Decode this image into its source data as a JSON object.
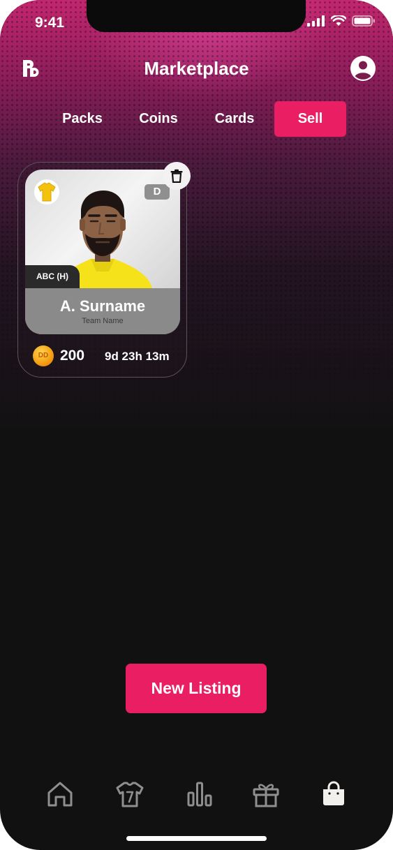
{
  "status_bar": {
    "time": "9:41"
  },
  "header": {
    "title": "Marketplace",
    "logo_icon": "app-logo-icon",
    "profile_icon": "user-profile-icon"
  },
  "tabs": [
    {
      "label": "Packs",
      "active": false
    },
    {
      "label": "Coins",
      "active": false
    },
    {
      "label": "Cards",
      "active": false
    },
    {
      "label": "Sell",
      "active": true
    }
  ],
  "listing_card": {
    "player_name": "A. Surname",
    "team_name": "Team Name",
    "fixture_tag": "ABC (H)",
    "position_badge": "D",
    "coin_label": "DD",
    "price": "200",
    "time_remaining": "9d 23h 13m"
  },
  "actions": {
    "new_listing_label": "New Listing"
  },
  "bottom_nav": [
    {
      "icon": "home-icon",
      "active": false
    },
    {
      "icon": "jersey-icon",
      "active": false
    },
    {
      "icon": "leaderboard-icon",
      "active": false
    },
    {
      "icon": "gift-icon",
      "active": false
    },
    {
      "icon": "shopping-bag-icon",
      "active": true
    }
  ],
  "colors": {
    "accent": "#e91e63",
    "background": "#121112",
    "header_gradient_top": "#c3266e"
  }
}
